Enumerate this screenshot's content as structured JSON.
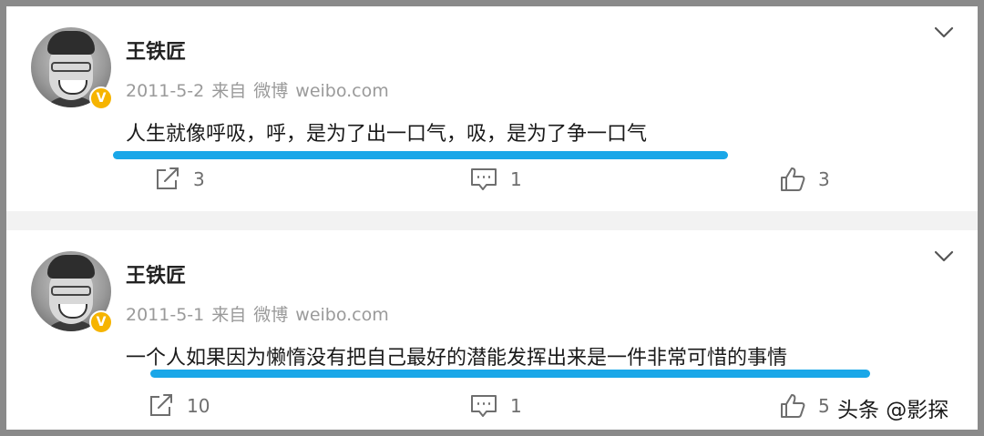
{
  "posts": [
    {
      "author": "王铁匠",
      "verified_badge": "V",
      "date": "2011-5-2",
      "source_prefix": "来自",
      "source_name": "微博",
      "source_url_text": "weibo.com",
      "content": "人生就像呼吸，呼，是为了出一口气，吸，是为了争一口气",
      "share_count": "3",
      "comment_count": "1",
      "like_count": "3"
    },
    {
      "author": "王铁匠",
      "verified_badge": "V",
      "date": "2011-5-1",
      "source_prefix": "来自",
      "source_name": "微博",
      "source_url_text": "weibo.com",
      "content": "一个人如果因为懒惰没有把自己最好的潜能发挥出来是一件非常可惜的事情",
      "share_count": "10",
      "comment_count": "1",
      "like_count": "5"
    }
  ],
  "watermark": "头条 @影探",
  "colors": {
    "underline": "#1aa7e8",
    "verified": "#f6b400",
    "meta_text": "#9a9a9a"
  },
  "icons": [
    "chevron-down-icon",
    "share-icon",
    "comment-icon",
    "like-icon"
  ]
}
